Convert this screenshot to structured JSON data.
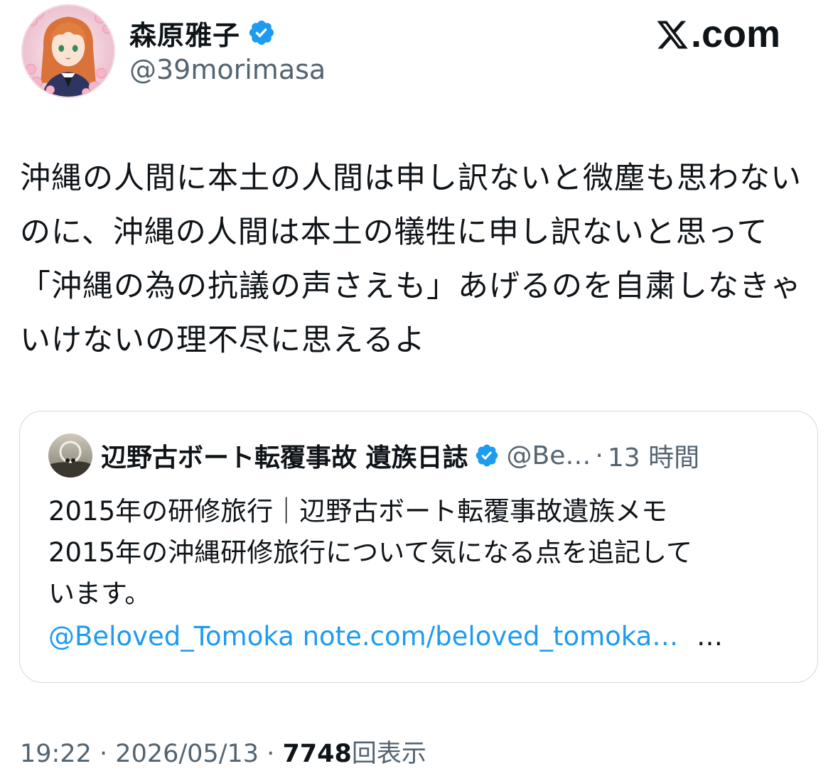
{
  "brand": {
    "logo_text": ".com",
    "logo_icon": "x-logo-icon"
  },
  "author": {
    "display_name": "森原雅子",
    "handle": "@39morimasa",
    "verified": true,
    "avatar_icon": "anime-avatar"
  },
  "tweet": {
    "text": "沖縄の人間に本土の人間は申し訳ないと微塵も思わないのに、沖縄の人間は本土の犠牲に申し訳ないと思って「沖縄の為の抗議の声さえも」あげるのを自粛しなきゃいけないの理不尽に思えるよ"
  },
  "quote": {
    "display_name": "辺野古ボート転覆事故 遺族日誌",
    "handle": "@Be…",
    "separator": "·",
    "time": "13 時間",
    "verified": true,
    "lines": [
      "2015年の研修旅行｜辺野古ボート転覆事故遺族メモ",
      "2015年の沖縄研修旅行について気になる点を追記して",
      "います。"
    ],
    "mention_link": "@Beloved_Tomoka",
    "url_link": "note.com/beloved_tomoka…",
    "more": "…"
  },
  "meta": {
    "time": "19:22",
    "sep1": "·",
    "date": "2026/05/13",
    "sep2": "·",
    "views_count": "7748",
    "views_label": "回表示"
  },
  "colors": {
    "text": "#0f1419",
    "secondary": "#536471",
    "link": "#1d9bf0",
    "badge": "#1d9bf0",
    "border": "#cfd9de"
  }
}
